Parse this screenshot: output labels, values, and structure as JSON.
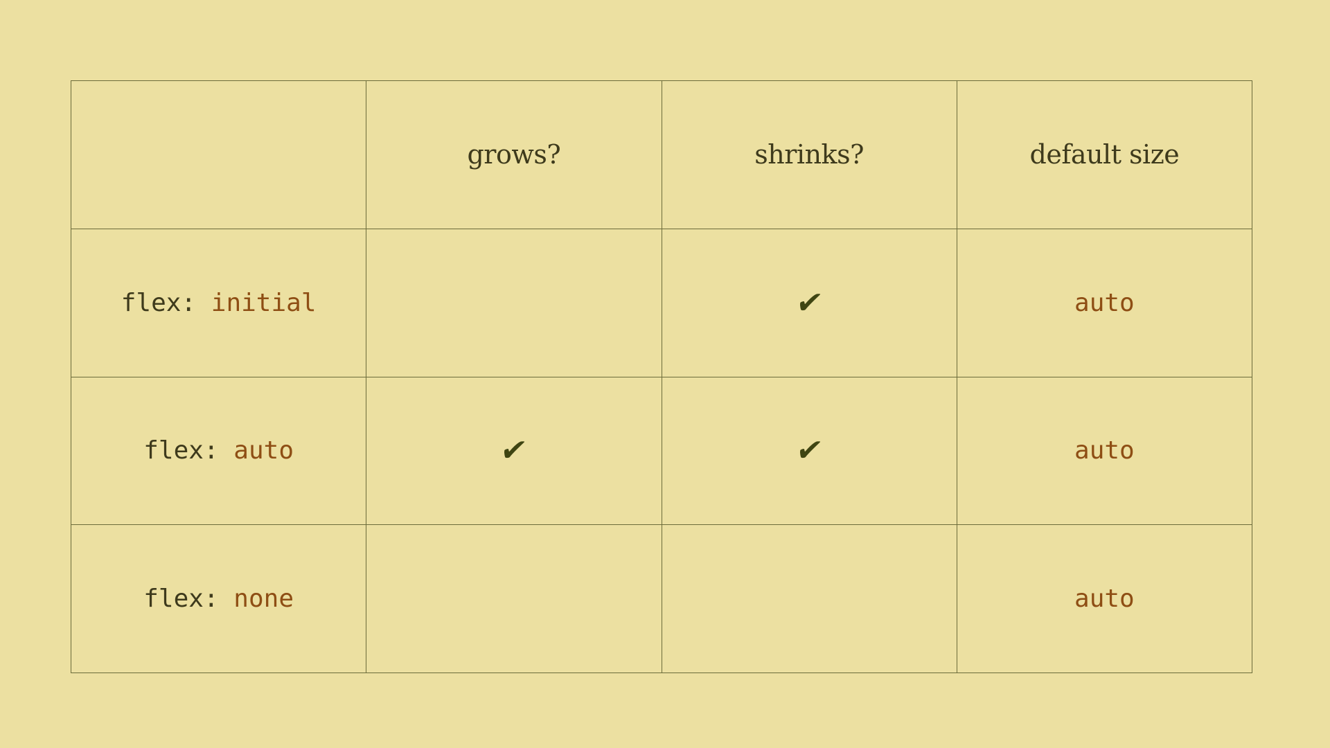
{
  "table": {
    "headers": [
      "",
      "grows?",
      "shrinks?",
      "default size"
    ],
    "rows": [
      {
        "key": "flex: ",
        "value": "initial",
        "grows": "",
        "shrinks": "✔",
        "default_size": "auto"
      },
      {
        "key": "flex: ",
        "value": "auto",
        "grows": "✔",
        "shrinks": "✔",
        "default_size": "auto"
      },
      {
        "key": "flex: ",
        "value": "none",
        "grows": "",
        "shrinks": "",
        "default_size": "auto"
      }
    ]
  },
  "colors": {
    "background": "#ECE0A1",
    "grid_line": "#6B6B3A",
    "header_text": "#3E3A1C",
    "code_keyword": "#3E3A1C",
    "code_value": "#8E4E14",
    "checkmark": "#3F4512"
  }
}
